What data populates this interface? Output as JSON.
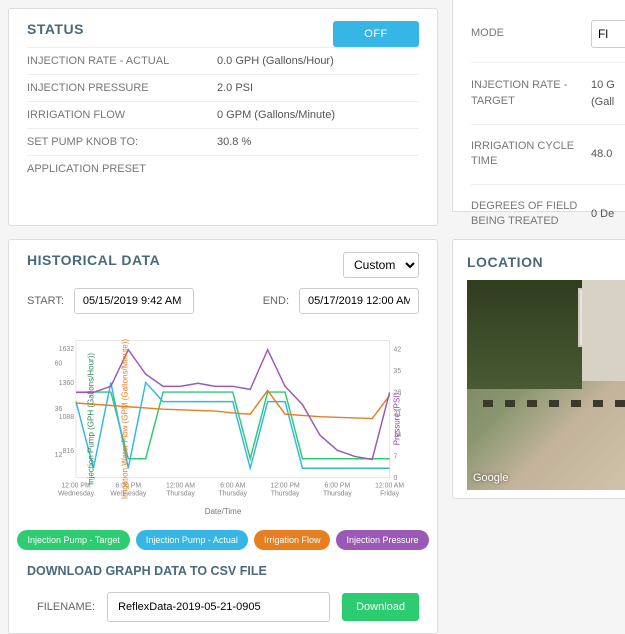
{
  "status": {
    "title": "STATUS",
    "off_btn": "OFF",
    "rows": [
      {
        "label": "INJECTION RATE - ACTUAL",
        "value": "0.0  GPH (Gallons/Hour)"
      },
      {
        "label": "INJECTION PRESSURE",
        "value": "2.0  PSI"
      },
      {
        "label": "IRRIGATION FLOW",
        "value": "0  GPM (Gallons/Minute)"
      },
      {
        "label": "SET PUMP KNOB TO:",
        "value": "30.8  %"
      },
      {
        "label": "APPLICATION PRESET",
        "value": ""
      }
    ]
  },
  "settings": {
    "rows": [
      {
        "label": "MODE",
        "value": "Fl"
      },
      {
        "label": "INJECTION RATE - TARGET",
        "value": "10 G\n(Gall"
      },
      {
        "label": "IRRIGATION CYCLE TIME",
        "value": "48.0"
      },
      {
        "label": "DEGREES OF FIELD BEING TREATED",
        "value": "0  De"
      }
    ]
  },
  "historical": {
    "title": "HISTORICAL DATA",
    "range_mode": "Custom",
    "start_label": "START:",
    "start_value": "05/15/2019 9:42 AM",
    "end_label": "END:",
    "end_value": "05/17/2019 12:00 AM",
    "legend": [
      "Injection Pump - Target",
      "Injection Pump - Actual",
      "Irrigation Flow",
      "Injection Pressure"
    ],
    "download_title": "DOWNLOAD GRAPH DATA TO CSV FILE",
    "filename_label": "FILENAME:",
    "filename_value": "ReflexData-2019-05-21-0905",
    "download_btn": "Download"
  },
  "location": {
    "title": "LOCATION",
    "attribution": "Google"
  },
  "chart_data": {
    "type": "line",
    "title": "",
    "xlabel": "Date/Time",
    "x_ticks": [
      "12:00 PM Wednesday",
      "6:00 PM Wednesday",
      "12:00 AM Thursday",
      "6:00 AM Thursday",
      "12:00 PM Thursday",
      "6:00 PM Thursday",
      "12:00 AM Friday"
    ],
    "left_axis_1": {
      "label": "Injection Pump (GPH (Gallons/Hour))",
      "ticks": [
        12,
        36,
        60
      ],
      "color": "#2e8b57"
    },
    "left_axis_2": {
      "label": "Irrigation Water Flow (GPM (Gallons/Minute))",
      "ticks": [
        816,
        1088,
        1360,
        1632
      ],
      "color": "#e67e22"
    },
    "right_axis": {
      "label": "Pressure (PSI)",
      "ticks": [
        0,
        7,
        14,
        21,
        28,
        35,
        42
      ],
      "color": "#8e44ad"
    },
    "series": [
      {
        "name": "Injection Pump - Target",
        "axis": "left1",
        "color": "#2ecc71",
        "values": [
          45,
          45,
          45,
          10,
          10,
          45,
          45,
          45,
          45,
          45,
          10,
          45,
          45,
          10,
          10,
          10,
          10,
          10,
          10
        ]
      },
      {
        "name": "Injection Pump - Actual",
        "axis": "left1",
        "color": "#35b6e6",
        "values": [
          40,
          5,
          50,
          5,
          50,
          40,
          40,
          40,
          40,
          40,
          5,
          40,
          40,
          5,
          5,
          5,
          5,
          5,
          5
        ]
      },
      {
        "name": "Irrigation Flow",
        "axis": "left2",
        "color": "#e67e22",
        "values": [
          1200,
          1190,
          1180,
          1170,
          1160,
          1150,
          1145,
          1140,
          1135,
          1120,
          1110,
          1300,
          1110,
          1100,
          1090,
          1085,
          1080,
          1075,
          1260
        ]
      },
      {
        "name": "Injection Pressure",
        "axis": "right",
        "color": "#9b59b6",
        "values": [
          28,
          28,
          30,
          42,
          34,
          30,
          30,
          31,
          30,
          30,
          29,
          42,
          30,
          24,
          14,
          9,
          7,
          6,
          28
        ]
      }
    ]
  }
}
